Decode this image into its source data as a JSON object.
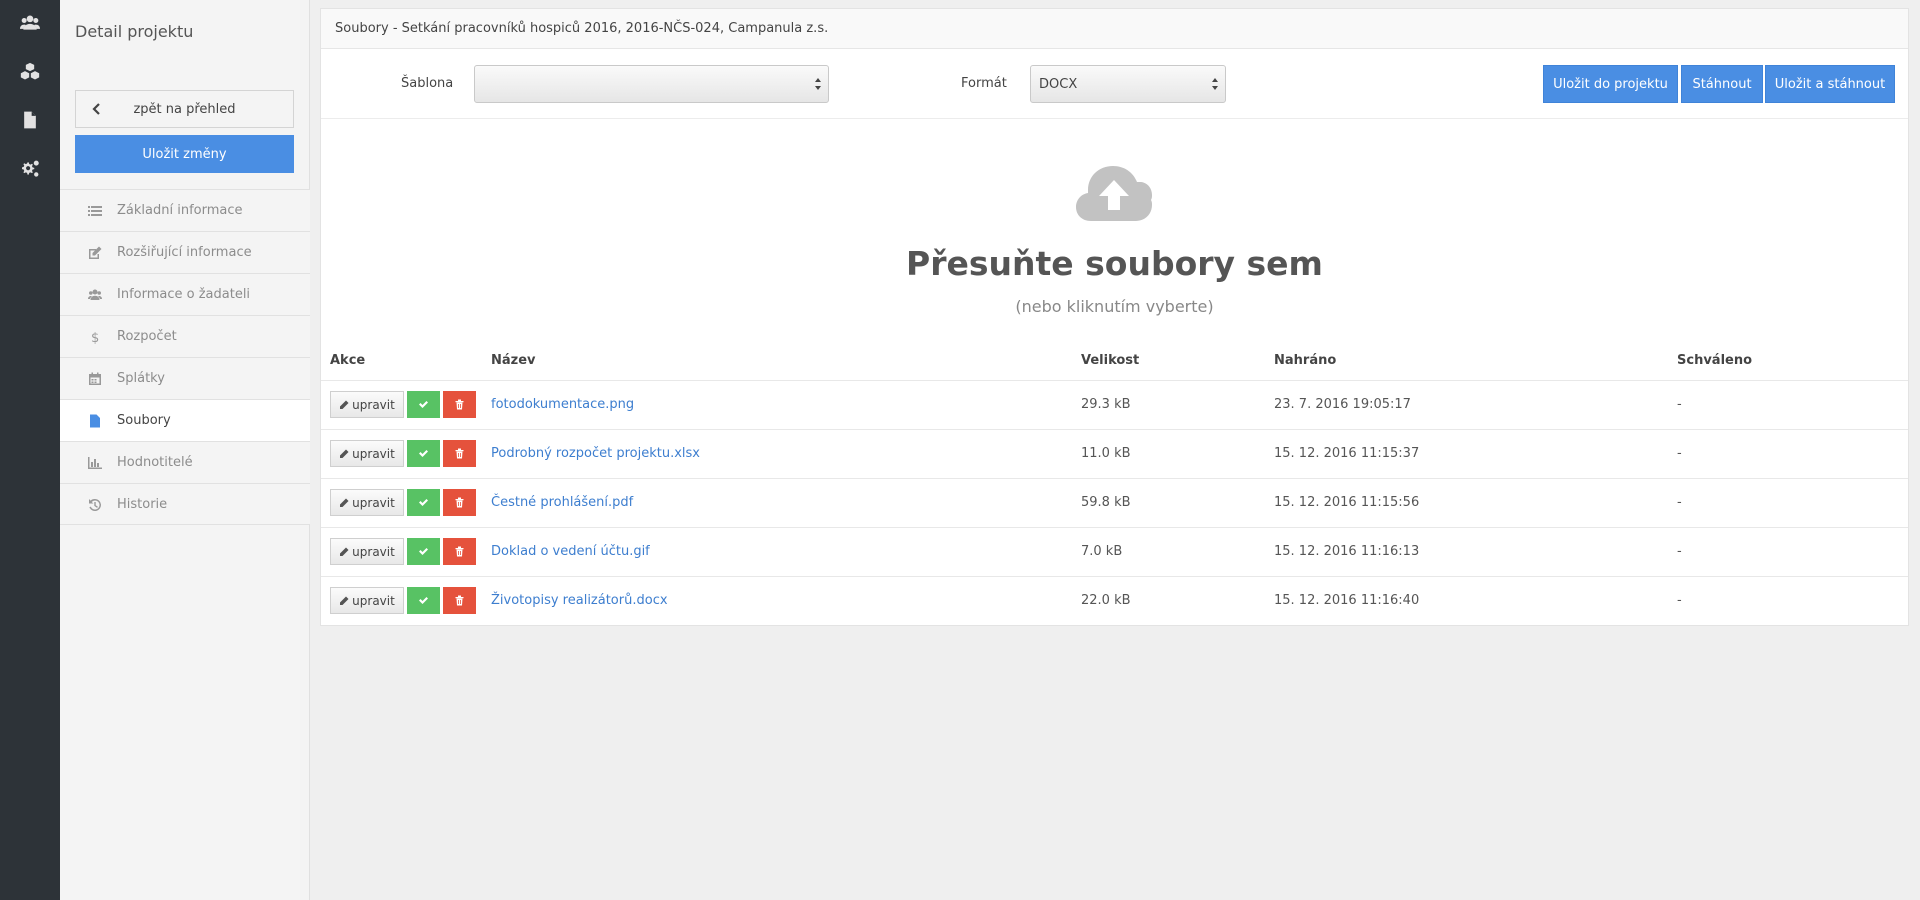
{
  "sidebar": {
    "title": "Detail projektu",
    "back_label": "zpět na přehled",
    "save_label": "Uložit změny",
    "items": [
      {
        "label": "Základní informace",
        "icon": "list-icon"
      },
      {
        "label": "Rozšiřující informace",
        "icon": "edit-icon"
      },
      {
        "label": "Informace o žadateli",
        "icon": "users-icon"
      },
      {
        "label": "Rozpočet",
        "icon": "dollar-icon"
      },
      {
        "label": "Splátky",
        "icon": "calendar-icon"
      },
      {
        "label": "Soubory",
        "icon": "file-icon",
        "active": true
      },
      {
        "label": "Hodnotitelé",
        "icon": "bar-chart-icon"
      },
      {
        "label": "Historie",
        "icon": "history-icon"
      }
    ]
  },
  "panel": {
    "title": "Soubory - Setkání pracovníků hospiců 2016, 2016-NČS-024, Campanula z.s."
  },
  "toolbar": {
    "template_label": "Šablona",
    "template_value": "",
    "format_label": "Formát",
    "format_value": "DOCX",
    "save_to_project_label": "Uložit do projektu",
    "download_label": "Stáhnout",
    "save_and_download_label": "Uložit a stáhnout"
  },
  "dropzone": {
    "title": "Přesuňte soubory sem",
    "subtitle": "(nebo kliknutím vyberte)"
  },
  "table": {
    "headers": {
      "actions": "Akce",
      "name": "Název",
      "size": "Velikost",
      "uploaded": "Nahráno",
      "approved": "Schváleno"
    },
    "edit_label": "upravit",
    "rows": [
      {
        "name": "fotodokumentace.png",
        "size": "29.3 kB",
        "uploaded": "23. 7. 2016 19:05:17",
        "approved": "-"
      },
      {
        "name": "Podrobný rozpočet projektu.xlsx",
        "size": "11.0 kB",
        "uploaded": "15. 12. 2016 11:15:37",
        "approved": "-"
      },
      {
        "name": "Čestné prohlášení.pdf",
        "size": "59.8 kB",
        "uploaded": "15. 12. 2016 11:15:56",
        "approved": "-"
      },
      {
        "name": "Doklad o vedení účtu.gif",
        "size": "7.0 kB",
        "uploaded": "15. 12. 2016 11:16:13",
        "approved": "-"
      },
      {
        "name": "Životopisy realizátorů.docx",
        "size": "22.0 kB",
        "uploaded": "15. 12. 2016 11:16:40",
        "approved": "-"
      }
    ]
  },
  "colors": {
    "accent": "#4a8ee3",
    "success": "#58c264",
    "danger": "#e5523c",
    "rail": "#2d3338"
  }
}
